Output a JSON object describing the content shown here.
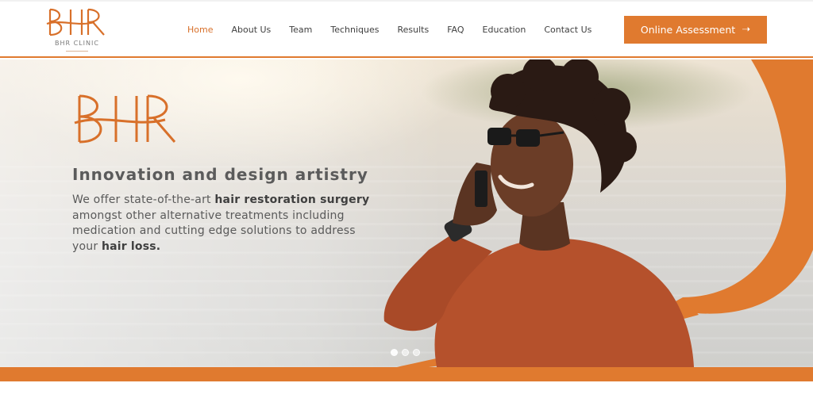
{
  "brand": {
    "logo_mark": "BHR",
    "caption": "BHR CLINIC"
  },
  "nav": {
    "items": [
      {
        "label": "Home",
        "active": true
      },
      {
        "label": "About Us",
        "active": false
      },
      {
        "label": "Team",
        "active": false
      },
      {
        "label": "Techniques",
        "active": false
      },
      {
        "label": "Results",
        "active": false
      },
      {
        "label": "FAQ",
        "active": false
      },
      {
        "label": "Education",
        "active": false
      },
      {
        "label": "Contact Us",
        "active": false
      }
    ]
  },
  "cta": {
    "label": "Online Assessment",
    "icon": "arrow-right-icon"
  },
  "hero": {
    "logo_mark": "BHR",
    "headline": "Innovation and design artistry",
    "body": {
      "part1": "We offer state-of-the-art ",
      "bold1": "hair restoration surgery",
      "part2": " amongst other alternative treatments including medication and cutting edge solutions to address your ",
      "bold2": "hair loss."
    },
    "slider": {
      "count": 3,
      "active_index": 0
    }
  },
  "colors": {
    "accent": "#e07a2f",
    "text": "#5a5a5a",
    "nav_active": "#d8702a"
  }
}
